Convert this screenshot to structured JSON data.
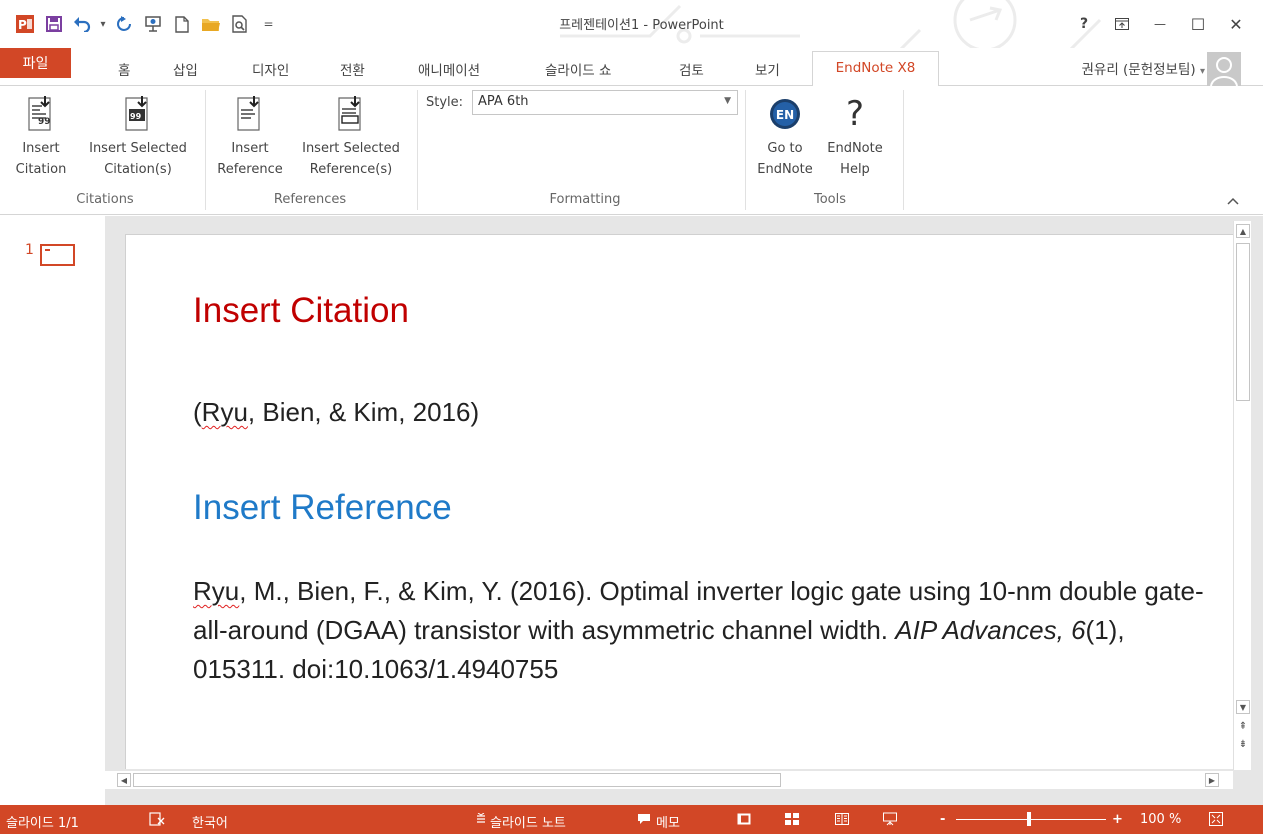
{
  "app": {
    "title": "프레젠테이션1 - PowerPoint",
    "user": "권유리 (문헌정보팀)",
    "user_dropdown_glyph": "▾"
  },
  "quick_access": {
    "undo_dropdown": "▾",
    "customize": "="
  },
  "window": {
    "help": "?",
    "minimize": "—",
    "maximize": "☐",
    "close": "✕"
  },
  "tabs": [
    "파일",
    "홈",
    "삽입",
    "디자인",
    "전환",
    "애니메이션",
    "슬라이드 쇼",
    "검토",
    "보기",
    "EndNote X8"
  ],
  "ribbon": {
    "citations": {
      "insert_citation": [
        "Insert",
        "Citation"
      ],
      "insert_selected_citations": [
        "Insert Selected",
        "Citation(s)"
      ],
      "label": "Citations"
    },
    "references": {
      "insert_reference": [
        "Insert",
        "Reference"
      ],
      "insert_selected_references": [
        "Insert Selected",
        "Reference(s)"
      ],
      "label": "References"
    },
    "formatting": {
      "style_label": "Style:",
      "style_value": "APA 6th",
      "label": "Formatting"
    },
    "tools": {
      "go_to_endnote": [
        "Go to",
        "EndNote"
      ],
      "endnote_help": [
        "EndNote",
        "Help"
      ],
      "en_badge": "EN",
      "help_glyph": "?",
      "label": "Tools"
    }
  },
  "thumbnails": {
    "slide_number": "1"
  },
  "slide": {
    "title1": "Insert Citation",
    "citation_name": "Ryu",
    "citation_rest": ", Bien, & Kim, 2016)",
    "citation_open": "(",
    "title2": "Insert Reference",
    "ref_name": "Ryu",
    "ref_text1": ", M., Bien, F., & Kim, Y. (2016). Optimal inverter logic gate using 10-nm double gate-all-around (DGAA) transistor with asymmetric channel width. ",
    "ref_journal": "AIP Advances, 6",
    "ref_text2": "(1), 015311. doi:10.1063/1.4940755"
  },
  "status": {
    "slide_count": "슬라이드 1/1",
    "language": "한국어",
    "notes": "슬라이드 노트",
    "comments": "메모",
    "zoom_minus": "-",
    "zoom_plus": "+",
    "zoom": "100 %",
    "zoom_level_percent": 100
  },
  "colors": {
    "accent": "#d24726",
    "title1": "#c00000",
    "title2": "#1f7ac8"
  }
}
